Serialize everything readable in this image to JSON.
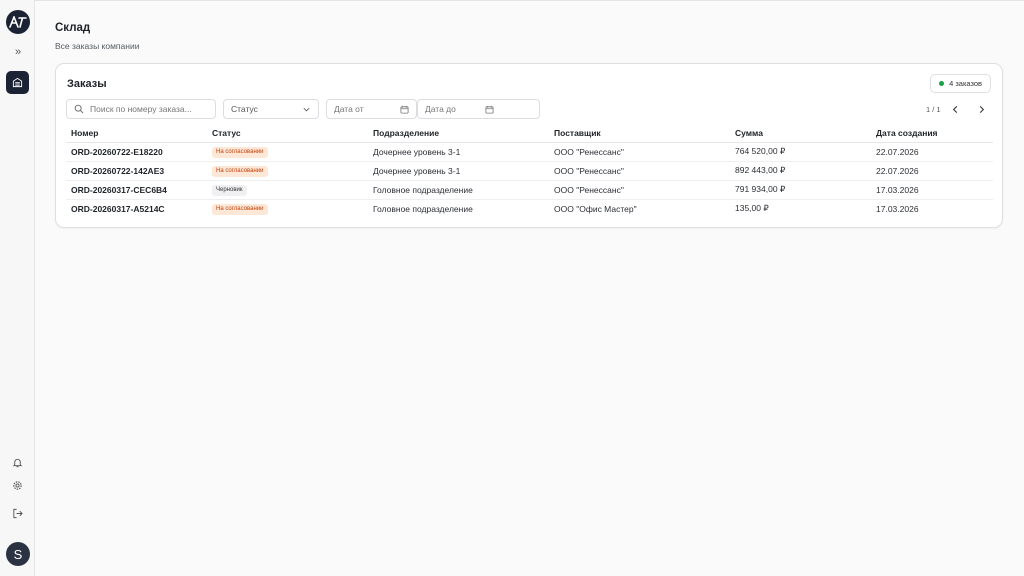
{
  "page": {
    "title": "Склад",
    "subtitle": "Все заказы компании"
  },
  "card": {
    "title": "Заказы",
    "count_label": "4 заказов"
  },
  "filters": {
    "search_placeholder": "Поиск по номеру заказа...",
    "status_label": "Статус",
    "date_from_label": "Дата от",
    "date_to_label": "Дата до"
  },
  "pagination": {
    "label": "1 / 1"
  },
  "table": {
    "headers": [
      "Номер",
      "Статус",
      "Подразделение",
      "Поставщик",
      "Сумма",
      "Дата создания"
    ],
    "rows": [
      {
        "number": "ORD-20260722-E18220",
        "status": "На согласовании",
        "status_type": "pending",
        "department": "Дочернее уровень 3-1",
        "supplier": "ООО \"Ренессанс\"",
        "amount": "764 520,00 ₽",
        "date": "22.07.2026"
      },
      {
        "number": "ORD-20260722-142AE3",
        "status": "На согласовании",
        "status_type": "pending",
        "department": "Дочернее уровень 3-1",
        "supplier": "ООО \"Ренессанс\"",
        "amount": "892 443,00 ₽",
        "date": "22.07.2026"
      },
      {
        "number": "ORD-20260317-CEC6B4",
        "status": "Черновик",
        "status_type": "draft",
        "department": "Головное подразделение",
        "supplier": "ООО \"Ренессанс\"",
        "amount": "791 934,00 ₽",
        "date": "17.03.2026"
      },
      {
        "number": "ORD-20260317-A5214C",
        "status": "На согласовании",
        "status_type": "pending",
        "department": "Головное подразделение",
        "supplier": "ООО \"Офис Мастер\"",
        "amount": "135,00 ₽",
        "date": "17.03.2026"
      }
    ]
  },
  "sidebar": {
    "avatar_letter": "S"
  },
  "colors": {
    "accent": "#1a2233",
    "pending_bg": "#fde7d6",
    "pending_text": "#c2410c",
    "draft_bg": "#f0f0f2",
    "status_dot": "#16a34a"
  },
  "icons": [
    "logo-icon",
    "expand-icon",
    "warehouse-icon",
    "bell-icon",
    "gear-icon",
    "logout-icon",
    "search-icon",
    "chevron-down-icon",
    "calendar-icon",
    "chevron-left-icon",
    "chevron-right-icon"
  ]
}
